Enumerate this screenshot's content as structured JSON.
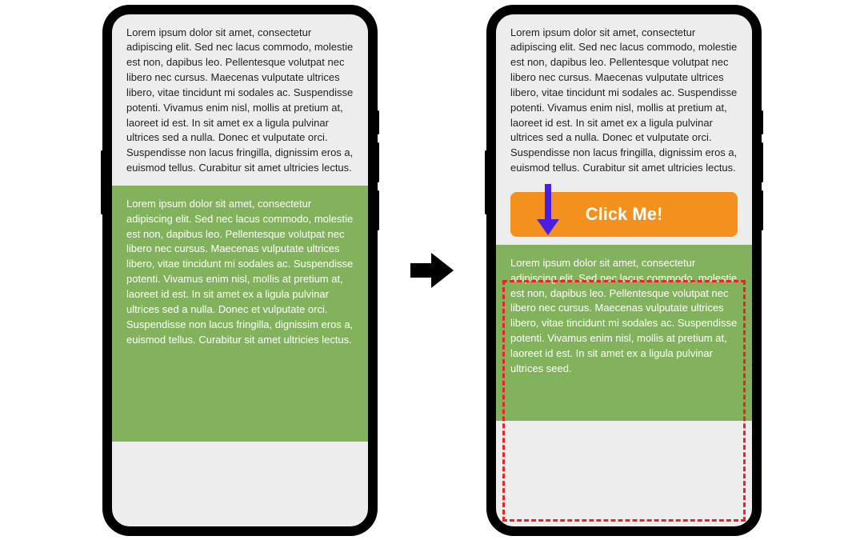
{
  "left": {
    "top_text": "Lorem ipsum dolor sit amet, consectetur adipiscing elit. Sed nec lacus commodo, molestie est non, dapibus leo. Pellentesque volutpat nec libero nec cursus. Maecenas vulputate ultrices libero, vitae tincidunt mi sodales ac. Suspendisse potenti. Vivamus enim nisl, mollis at pretium at, laoreet id est. In sit amet ex a ligula pulvinar ultrices sed a nulla. Donec et vulputate orci. Suspendisse non lacus fringilla, dignissim eros a, euismod tellus. Curabitur sit amet ultricies lectus.",
    "bottom_text": "Lorem ipsum dolor sit amet, consectetur adipiscing elit. Sed nec lacus commodo, molestie est non, dapibus leo. Pellentesque volutpat nec libero nec cursus. Maecenas vulputate ultrices libero, vitae tincidunt mi sodales ac. Suspendisse potenti. Vivamus enim nisl, mollis at pretium at, laoreet id est. In sit amet ex a ligula pulvinar ultrices sed a nulla. Donec et vulputate orci. Suspendisse non lacus fringilla, dignissim eros a, euismod tellus. Curabitur sit amet ultricies lectus."
  },
  "right": {
    "top_text": "Lorem ipsum dolor sit amet, consectetur adipiscing elit. Sed nec lacus commodo, molestie est non, dapibus leo. Pellentesque volutpat nec libero nec cursus. Maecenas vulputate ultrices libero, vitae tincidunt mi sodales ac. Suspendisse potenti. Vivamus enim nisl, mollis at pretium at, laoreet id est. In sit amet ex a ligula pulvinar ultrices sed a nulla. Donec et vulputate orci. Suspendisse non lacus fringilla, dignissim eros a, euismod tellus. Curabitur sit amet ultricies lectus.",
    "button_label": "Click Me!",
    "bottom_text": "Lorem ipsum dolor sit amet, consectetur adipiscing elit. Sed nec lacus commodo, molestie est non, dapibus leo. Pellentesque volutpat nec libero nec cursus. Maecenas vulputate ultrices libero, vitae tincidunt mi sodales ac. Suspendisse potenti. Vivamus enim nisl, mollis at pretium at, laoreet id est. In sit amet ex a ligula pulvinar ultrices seed."
  }
}
